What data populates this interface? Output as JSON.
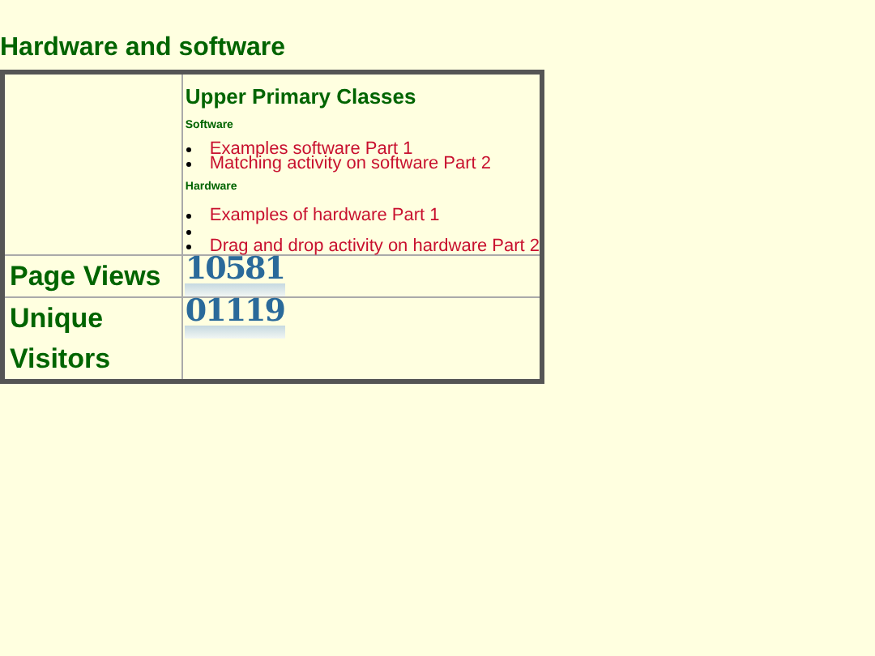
{
  "heading": "Hardware and software",
  "classes": {
    "title": "Upper Primary Classes",
    "sections": [
      {
        "label": "Software",
        "items": [
          {
            "kind": "link",
            "text": "Examples software Part 1"
          },
          {
            "kind": "link",
            "text": "Matching activity on software Part 2"
          }
        ]
      },
      {
        "label": "Hardware",
        "items": [
          {
            "kind": "link",
            "text": "Examples of hardware Part 1"
          },
          {
            "kind": "blank"
          },
          {
            "kind": "link",
            "text": "Drag and drop activity on hardware Part 2"
          }
        ]
      }
    ]
  },
  "counters": [
    {
      "label": "Page Views",
      "value": "10581"
    },
    {
      "label": "Unique Visitors",
      "value": "01119"
    }
  ]
}
